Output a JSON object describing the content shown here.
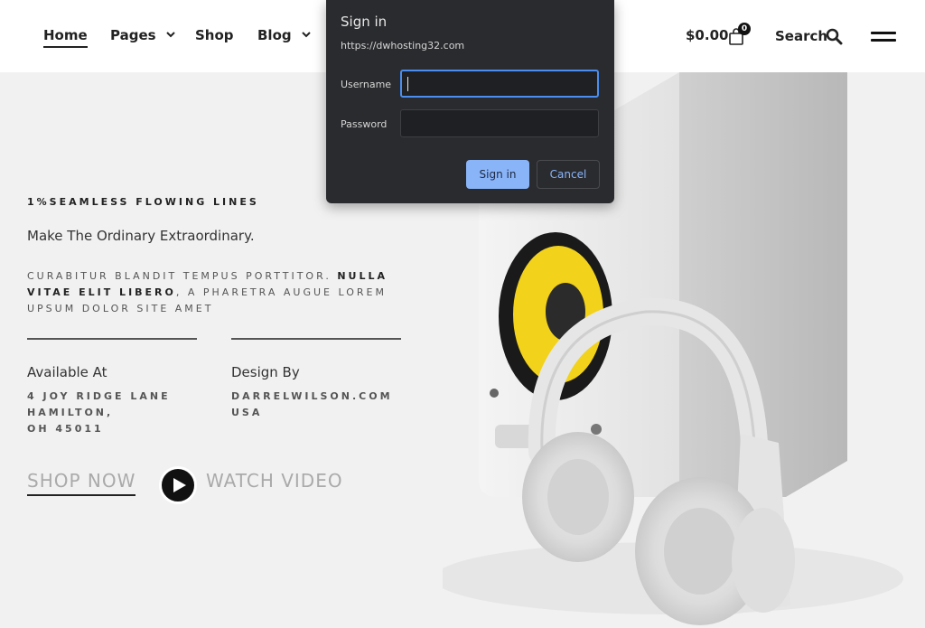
{
  "header": {
    "nav": [
      {
        "label": "Home"
      },
      {
        "label": "Pages"
      },
      {
        "label": "Shop"
      },
      {
        "label": "Blog"
      }
    ],
    "cart_total": "$0.00",
    "cart_count": "0",
    "search_label": "Search"
  },
  "hero": {
    "eyebrow": "1%SEAMLESS FLOWING LINES",
    "tagline": "Make The Ordinary Extraordinary.",
    "desc_1": "CURABITUR BLANDIT TEMPUS PORTTITOR. ",
    "desc_bold": "NULLA VITAE ELIT LIBERO",
    "desc_2": ", A PHARETRA AUGUE LOREM UPSUM DOLOR SITE AMET",
    "available_title": "Available At",
    "available_lines": [
      "4 JOY RIDGE LANE",
      "HAMILTON,",
      "OH 45011"
    ],
    "design_title": "Design By",
    "design_lines": [
      "DARRELWILSON.COM",
      "USA"
    ],
    "shop_now": "SHOP NOW",
    "watch_video": "WATCH VIDEO"
  },
  "dialog": {
    "title": "Sign in",
    "url": "https://dwhosting32.com",
    "username_label": "Username",
    "username_value": "",
    "password_label": "Password",
    "password_value": "",
    "signin_label": "Sign in",
    "cancel_label": "Cancel"
  },
  "colors": {
    "accent_blue": "#8ab4f8",
    "dialog_bg": "#2a2b2e",
    "speaker_cone": "#f2d21b"
  },
  "icons": [
    "chevron-down-icon",
    "cart-icon",
    "search-icon",
    "hamburger-icon",
    "play-icon"
  ]
}
